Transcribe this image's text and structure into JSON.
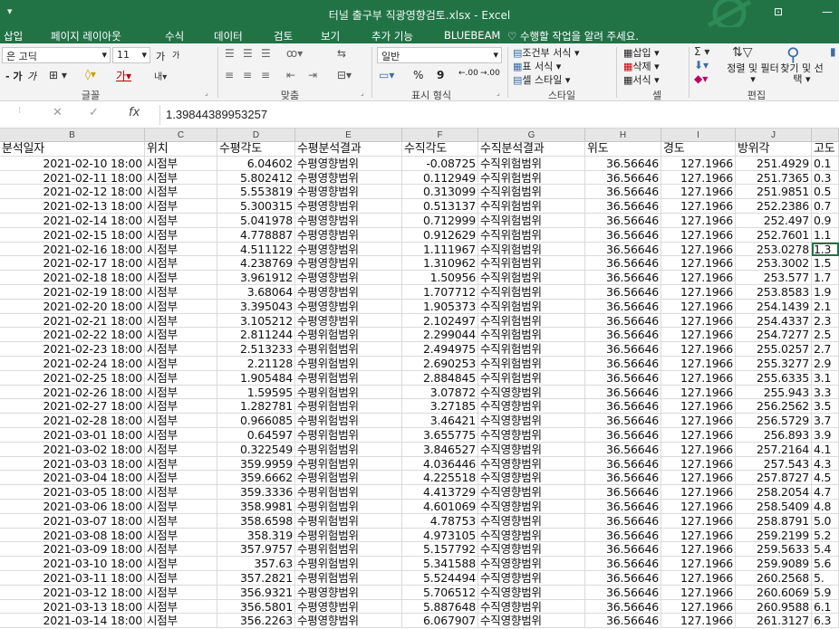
{
  "window": {
    "title": "터널 출구부 직광영향검토.xlsx - Excel",
    "quick_access": "▾"
  },
  "tabs": [
    "삽입",
    "페이지 레이아웃",
    "수식",
    "데이터",
    "검토",
    "보기",
    "추가 기능",
    "BLUEBEAM"
  ],
  "tell_me": "수행할 작업을 알려 주세요.",
  "ribbon": {
    "font_name": "은 고딕",
    "font_size": "11",
    "font_grow": "가",
    "font_shrink": "가",
    "bold": "가",
    "italic": "가",
    "number_format": "일반",
    "percent": "%",
    "comma": "9",
    "decimal_up": ".00",
    "decimal_down": ".00",
    "conditional_format": "조건부 서식 ▾",
    "table_format": "표 서식 ▾",
    "cell_style": "셀 스타일 ▾",
    "insert": "삽입 ▾",
    "delete": "삭제 ▾",
    "format": "서식 ▾",
    "sort_filter": "정렬 및 필터 ▾",
    "find_select": "찾기 및 선택 ▾",
    "groups": {
      "font": "글꼴",
      "alignment": "맞춤",
      "number": "표시 형식",
      "styles": "스타일",
      "cells": "셀",
      "editing": "편집"
    }
  },
  "formula_bar": {
    "value": "1.39844389953257",
    "fx": "fx"
  },
  "columns": [
    "B",
    "C",
    "D",
    "E",
    "F",
    "G",
    "H",
    "I",
    "J"
  ],
  "header": [
    "분석일자",
    "위치",
    "수평각도",
    "수평분석결과",
    "수직각도",
    "수직분석결과",
    "위도",
    "경도",
    "방위각",
    "고도"
  ],
  "rows": [
    [
      "2021-02-10 18:00",
      "시점부",
      "6.04602",
      "수평영향범위",
      "-0.08725",
      "수직위험범위",
      "36.56646",
      "127.1966",
      "251.4929",
      "0.1"
    ],
    [
      "2021-02-11 18:00",
      "시점부",
      "5.802412",
      "수평영향범위",
      "0.112949",
      "수직위험범위",
      "36.56646",
      "127.1966",
      "251.7365",
      "0.3"
    ],
    [
      "2021-02-12 18:00",
      "시점부",
      "5.553819",
      "수평영향범위",
      "0.313099",
      "수직위험범위",
      "36.56646",
      "127.1966",
      "251.9851",
      "0.5"
    ],
    [
      "2021-02-13 18:00",
      "시점부",
      "5.300315",
      "수평영향범위",
      "0.513137",
      "수직위험범위",
      "36.56646",
      "127.1966",
      "252.2386",
      "0.7"
    ],
    [
      "2021-02-14 18:00",
      "시점부",
      "5.041978",
      "수평영향범위",
      "0.712999",
      "수직위험범위",
      "36.56646",
      "127.1966",
      "252.497",
      "0.9"
    ],
    [
      "2021-02-15 18:00",
      "시점부",
      "4.778887",
      "수평영향범위",
      "0.912629",
      "수직위험범위",
      "36.56646",
      "127.1966",
      "252.7601",
      "1.1"
    ],
    [
      "2021-02-16 18:00",
      "시점부",
      "4.511122",
      "수평영향범위",
      "1.111967",
      "수직위험범위",
      "36.56646",
      "127.1966",
      "253.0278",
      "1.3"
    ],
    [
      "2021-02-17 18:00",
      "시점부",
      "4.238769",
      "수평영향범위",
      "1.310962",
      "수직위험범위",
      "36.56646",
      "127.1966",
      "253.3002",
      "1.5"
    ],
    [
      "2021-02-18 18:00",
      "시점부",
      "3.961912",
      "수평영향범위",
      "1.50956",
      "수직위험범위",
      "36.56646",
      "127.1966",
      "253.577",
      "1.7"
    ],
    [
      "2021-02-19 18:00",
      "시점부",
      "3.68064",
      "수평영향범위",
      "1.707712",
      "수직위험범위",
      "36.56646",
      "127.1966",
      "253.8583",
      "1.9"
    ],
    [
      "2021-02-20 18:00",
      "시점부",
      "3.395043",
      "수평영향범위",
      "1.905373",
      "수직위험범위",
      "36.56646",
      "127.1966",
      "254.1439",
      "2.1"
    ],
    [
      "2021-02-21 18:00",
      "시점부",
      "3.105212",
      "수평영향범위",
      "2.102497",
      "수직위험범위",
      "36.56646",
      "127.1966",
      "254.4337",
      "2.3"
    ],
    [
      "2021-02-22 18:00",
      "시점부",
      "2.811244",
      "수평위험범위",
      "2.299044",
      "수직위험범위",
      "36.56646",
      "127.1966",
      "254.7277",
      "2.5"
    ],
    [
      "2021-02-23 18:00",
      "시점부",
      "2.513233",
      "수평위험범위",
      "2.494975",
      "수직위험범위",
      "36.56646",
      "127.1966",
      "255.0257",
      "2.7"
    ],
    [
      "2021-02-24 18:00",
      "시점부",
      "2.21128",
      "수평위험범위",
      "2.690253",
      "수직위험범위",
      "36.56646",
      "127.1966",
      "255.3277",
      "2.9"
    ],
    [
      "2021-02-25 18:00",
      "시점부",
      "1.905484",
      "수평위험범위",
      "2.884845",
      "수직위험범위",
      "36.56646",
      "127.1966",
      "255.6335",
      "3.1"
    ],
    [
      "2021-02-26 18:00",
      "시점부",
      "1.59595",
      "수평위험범위",
      "3.07872",
      "수직영향범위",
      "36.56646",
      "127.1966",
      "255.943",
      "3.3"
    ],
    [
      "2021-02-27 18:00",
      "시점부",
      "1.282781",
      "수평위험범위",
      "3.27185",
      "수직영향범위",
      "36.56646",
      "127.1966",
      "256.2562",
      "3.5"
    ],
    [
      "2021-02-28 18:00",
      "시점부",
      "0.966085",
      "수평위험범위",
      "3.46421",
      "수직영향범위",
      "36.56646",
      "127.1966",
      "256.5729",
      "3.7"
    ],
    [
      "2021-03-01 18:00",
      "시점부",
      "0.64597",
      "수평위험범위",
      "3.655775",
      "수직영향범위",
      "36.56646",
      "127.1966",
      "256.893",
      "3.9"
    ],
    [
      "2021-03-02 18:00",
      "시점부",
      "0.322549",
      "수평위험범위",
      "3.846527",
      "수직영향범위",
      "36.56646",
      "127.1966",
      "257.2164",
      "4.1"
    ],
    [
      "2021-03-03 18:00",
      "시점부",
      "359.9959",
      "수평위험범위",
      "4.036446",
      "수직영향범위",
      "36.56646",
      "127.1966",
      "257.543",
      "4.3"
    ],
    [
      "2021-03-04 18:00",
      "시점부",
      "359.6662",
      "수평위험범위",
      "4.225518",
      "수직영향범위",
      "36.56646",
      "127.1966",
      "257.8727",
      "4.5"
    ],
    [
      "2021-03-05 18:00",
      "시점부",
      "359.3336",
      "수평위험범위",
      "4.413729",
      "수직영향범위",
      "36.56646",
      "127.1966",
      "258.2054",
      "4.7"
    ],
    [
      "2021-03-06 18:00",
      "시점부",
      "358.9981",
      "수평위험범위",
      "4.601069",
      "수직영향범위",
      "36.56646",
      "127.1966",
      "258.5409",
      "4.8"
    ],
    [
      "2021-03-07 18:00",
      "시점부",
      "358.6598",
      "수평위험범위",
      "4.78753",
      "수직영향범위",
      "36.56646",
      "127.1966",
      "258.8791",
      "5.0"
    ],
    [
      "2021-03-08 18:00",
      "시점부",
      "358.319",
      "수평위험범위",
      "4.973105",
      "수직영향범위",
      "36.56646",
      "127.1966",
      "259.2199",
      "5.2"
    ],
    [
      "2021-03-09 18:00",
      "시점부",
      "357.9757",
      "수평위험범위",
      "5.157792",
      "수직영향범위",
      "36.56646",
      "127.1966",
      "259.5633",
      "5.4"
    ],
    [
      "2021-03-10 18:00",
      "시점부",
      "357.63",
      "수평위험범위",
      "5.341588",
      "수직영향범위",
      "36.56646",
      "127.1966",
      "259.9089",
      "5.6"
    ],
    [
      "2021-03-11 18:00",
      "시점부",
      "357.2821",
      "수평위험범위",
      "5.524494",
      "수직영향범위",
      "36.56646",
      "127.1966",
      "260.2568",
      "5."
    ],
    [
      "2021-03-12 18:00",
      "시점부",
      "356.9321",
      "수평영향범위",
      "5.706512",
      "수직영향범위",
      "36.56646",
      "127.1966",
      "260.6069",
      "5.9"
    ],
    [
      "2021-03-13 18:00",
      "시점부",
      "356.5801",
      "수평영향범위",
      "5.887648",
      "수직영향범위",
      "36.56646",
      "127.1966",
      "260.9588",
      "6.1"
    ],
    [
      "2021-03-14 18:00",
      "시점부",
      "356.2263",
      "수평영향범위",
      "6.067907",
      "수직영향범위",
      "36.56646",
      "127.1966",
      "261.3127",
      "6.3"
    ]
  ]
}
